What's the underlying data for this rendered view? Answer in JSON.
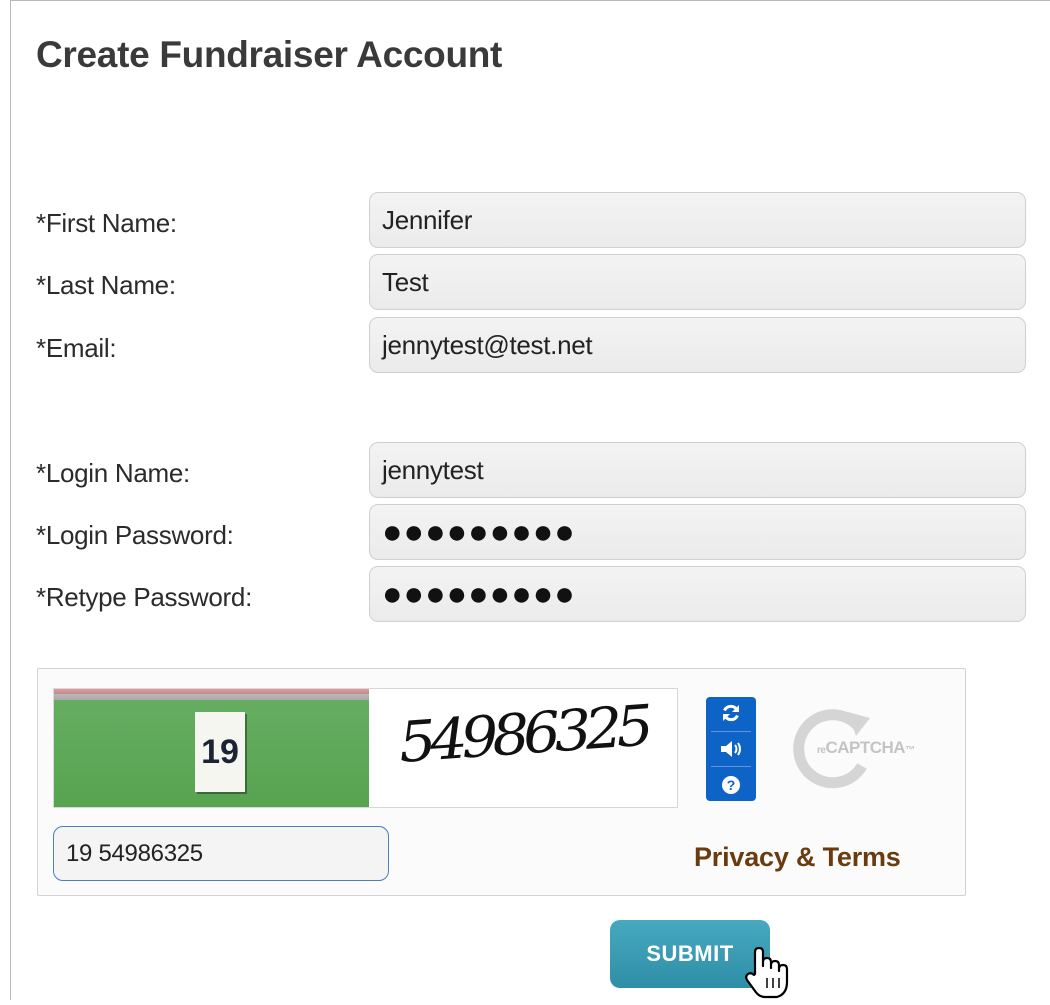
{
  "form": {
    "title": "Create Fundraiser Account",
    "fields": [
      {
        "label": "*First Name:",
        "value": "Jennifer",
        "type": "text"
      },
      {
        "label": "*Last Name:",
        "value": "Test",
        "type": "text"
      },
      {
        "label": "*Email:",
        "value": "jennytest@test.net",
        "type": "text"
      },
      {
        "label": "*Login Name:",
        "value": "jennytest",
        "type": "text"
      },
      {
        "label": "*Login Password:",
        "value": "●●●●●●●●●",
        "type": "password"
      },
      {
        "label": "*Retype Password:",
        "value": "●●●●●●●●●",
        "type": "password"
      }
    ]
  },
  "captcha": {
    "image_number": "19",
    "distorted_text": "54986325",
    "logo_text_re": "re",
    "logo_text": "CAPTCHA",
    "logo_tm": "™",
    "response_value": "19 54986325",
    "privacy_link": "Privacy & Terms",
    "buttons": [
      "refresh-icon",
      "audio-icon",
      "help-icon"
    ],
    "accent_color": "#0d63c6"
  },
  "submit": {
    "label": "SUBMIT",
    "color": "#3a9db4"
  }
}
